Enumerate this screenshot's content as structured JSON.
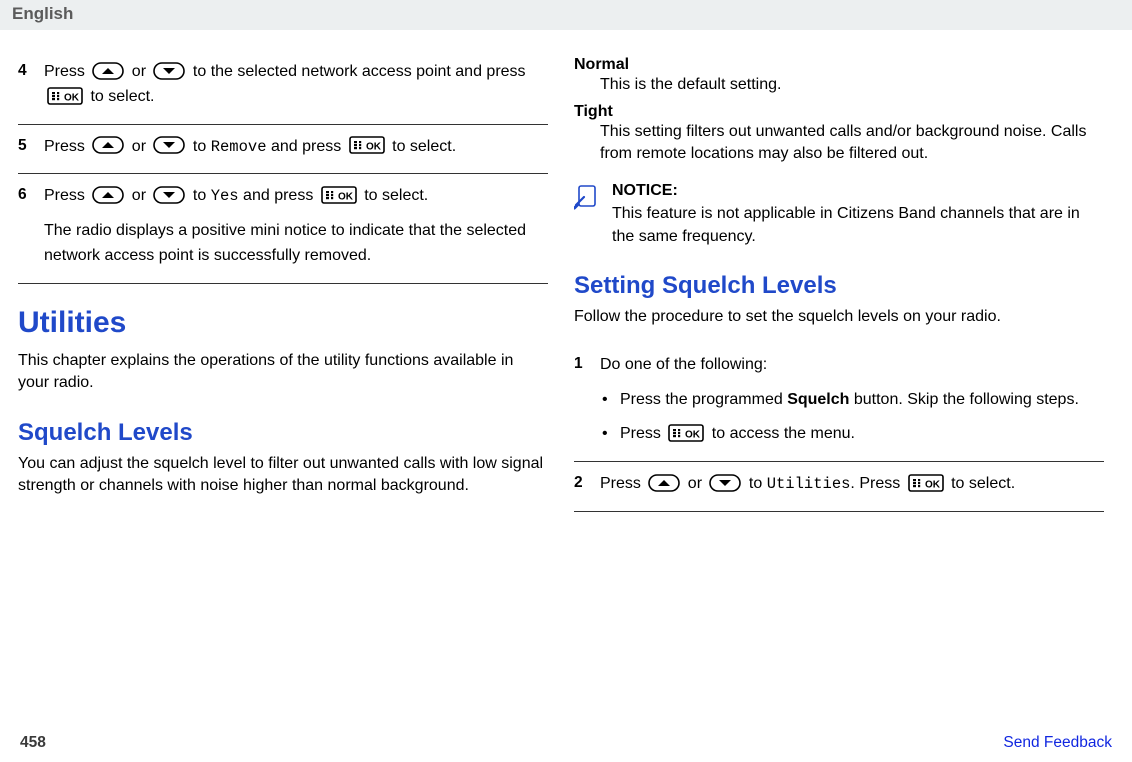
{
  "header": {
    "language": "English"
  },
  "left": {
    "steps": [
      {
        "num": "4",
        "parts": [
          "Press ",
          "@UP",
          " or ",
          "@DOWN",
          " to the selected network access point and press ",
          "@OK",
          " to select."
        ]
      },
      {
        "num": "5",
        "parts": [
          "Press ",
          "@UP",
          " or ",
          "@DOWN",
          " to ",
          "@MONO:Remove",
          " and press ",
          "@OK",
          " to select."
        ]
      },
      {
        "num": "6",
        "parts": [
          "Press ",
          "@UP",
          " or ",
          "@DOWN",
          " to ",
          "@MONO:Yes",
          " and press ",
          "@OK",
          " to select."
        ],
        "extra": "The radio displays a positive mini notice to indicate that the selected network access point is successfully removed."
      }
    ],
    "utilities": {
      "title": "Utilities",
      "intro": "This chapter explains the operations of the utility functions available in your radio."
    },
    "squelch": {
      "title": "Squelch Levels",
      "intro": "You can adjust the squelch level to filter out unwanted calls with low signal strength or channels with noise higher than normal background."
    }
  },
  "right": {
    "defs": [
      {
        "term": "Normal",
        "desc": "This is the default setting."
      },
      {
        "term": "Tight",
        "desc": "This setting filters out unwanted calls and/or background noise. Calls from remote locations may also be filtered out."
      }
    ],
    "notice": {
      "head": "NOTICE:",
      "body": "This feature is not applicable in Citizens Band channels that are in the same frequency."
    },
    "setting": {
      "title": "Setting Squelch Levels",
      "intro": "Follow the procedure to set the squelch levels on your radio.",
      "steps": [
        {
          "num": "1",
          "lead": "Do one of the following:",
          "bullets": [
            {
              "parts": [
                "Press the programmed ",
                "@BOLD:Squelch",
                " button. Skip the following steps."
              ]
            },
            {
              "parts": [
                "Press ",
                "@OK",
                " to access the menu."
              ]
            }
          ]
        },
        {
          "num": "2",
          "parts": [
            "Press ",
            "@UP",
            " or ",
            "@DOWN",
            " to ",
            "@MONO:Utilities",
            ". Press ",
            "@OK",
            " to select."
          ]
        }
      ]
    }
  },
  "footer": {
    "page": "458",
    "feedback": "Send Feedback"
  }
}
